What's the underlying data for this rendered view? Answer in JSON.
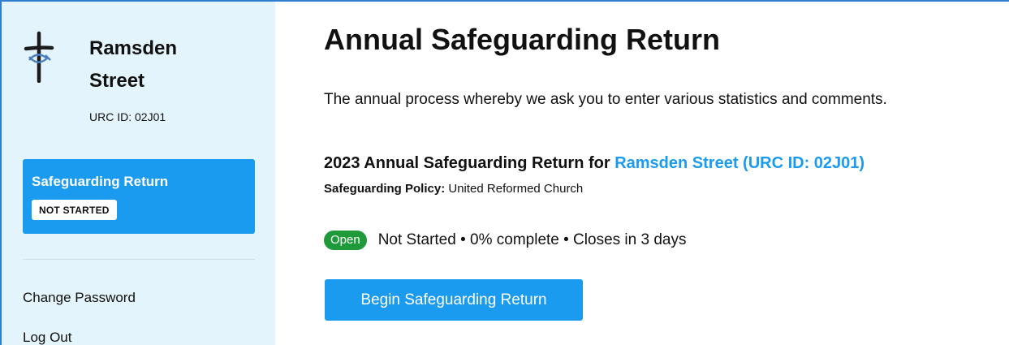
{
  "sidebar": {
    "church_name_line1": "Ramsden",
    "church_name_line2": "Street",
    "urc_id": "URC ID: 02J01",
    "nav_card": {
      "title": "Safeguarding Return",
      "status": "NOT STARTED"
    },
    "links": [
      "Change Password",
      "Log Out"
    ]
  },
  "main": {
    "title": "Annual Safeguarding Return",
    "intro": "The annual process whereby we ask you to enter various statistics and comments.",
    "return_heading_prefix": "2023 Annual Safeguarding Return for ",
    "return_heading_link": "Ramsden Street (URC ID: 02J01)",
    "policy_label": "Safeguarding Policy:",
    "policy_value": " United Reformed Church",
    "open_badge": "Open",
    "status_text": "Not Started • 0% complete • Closes in 3 days",
    "begin_button": "Begin Safeguarding Return"
  },
  "colors": {
    "accent": "#1a9bef",
    "sidebar_bg": "#e4f4fd",
    "open_green": "#1f9a3a"
  },
  "icons": {
    "logo": "cross-fish-logo-icon"
  }
}
